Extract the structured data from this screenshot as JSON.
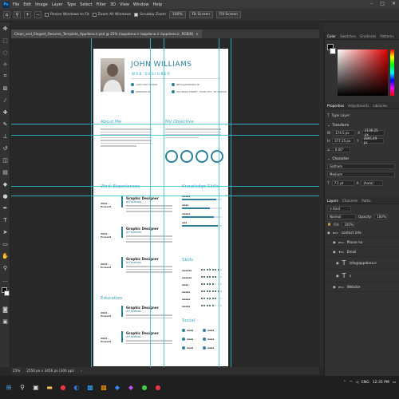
{
  "app": {
    "menu": [
      "File",
      "Edit",
      "Image",
      "Layer",
      "Type",
      "Select",
      "Filter",
      "3D",
      "View",
      "Window",
      "Help"
    ],
    "logo": "Ps"
  },
  "options": {
    "resize_windows": "Resize Windows to Fit",
    "zoom_all": "Zoom All Windows",
    "scrubby": "Scrubby Zoom",
    "zoom_value": "100%",
    "fit_screen": "Fit Screen",
    "fill_screen": "Fill Screen"
  },
  "document": {
    "tab_title": "Clean_and_Elegant_Resume_Template_Appdona.ir.psd @ 25% (/appdona.ir /appdona.ir /appdona.ir, RGB/8)",
    "zoom": "25%",
    "doc_size": "2550 px x 3456 px (300 ppi)"
  },
  "resume": {
    "name": "JOHN WILLIAMS",
    "title": "WEB DESIGNER",
    "phone": "+000 000 000000",
    "email": "INFO@APPDONA.IR",
    "web": "APPDONA.IR",
    "address": "000 MAIN STREET, YOUR CITY, NY 000000",
    "about_heading": "About Me",
    "objective_heading": "My Objective",
    "experience_heading": "Work Experiences",
    "knowledge_heading": "Knowledge Skills",
    "education_heading": "Education",
    "skills_heading": "Skills",
    "social_heading": "Social",
    "jobs": [
      {
        "date": "2016 - Present",
        "title": "Graphic Designer",
        "company": "at Facebook"
      },
      {
        "date": "2016 - Present",
        "title": "Graphic Designer",
        "company": "at Facebook"
      },
      {
        "date": "2016 - Present",
        "title": "Graphic Designer",
        "company": "at Facebook"
      }
    ],
    "education": [
      {
        "date": "2016 - Present",
        "title": "Graphic Designer",
        "company": "at Facebook"
      },
      {
        "date": "2016 - Present",
        "title": "Graphic Designer",
        "company": "at Facebook"
      }
    ]
  },
  "panels": {
    "color_tabs": [
      "Color",
      "Swatches",
      "Gradients",
      "Patterns"
    ],
    "prop_tabs": [
      "Properties",
      "Adjustments",
      "Libraries"
    ],
    "type_layer": "Type Layer",
    "transform": "Transform",
    "w_val": "174.5 px",
    "x_val": "2136.25 px",
    "h_val": "377.25 px",
    "y_val": "2895.49 px",
    "angle": "0.00°",
    "character": "Character",
    "font": "Gotham",
    "weight": "Medium",
    "size": "7.1 pt",
    "leading": "(Auto)",
    "layer_tabs": [
      "Layers",
      "Channels",
      "Paths"
    ],
    "blend": "Normal",
    "opacity_label": "Opacity:",
    "opacity": "100%",
    "fill_label": "Fill:",
    "fill": "100%",
    "layers": [
      "contact info",
      "Phone no",
      "Email",
      "info@appdona.ir",
      "Website"
    ]
  },
  "taskbar": {
    "lang": "ENG",
    "time": "12:35 PM"
  },
  "colors": {
    "accent": "#2d7f9a",
    "guide": "#2ec5d6"
  }
}
